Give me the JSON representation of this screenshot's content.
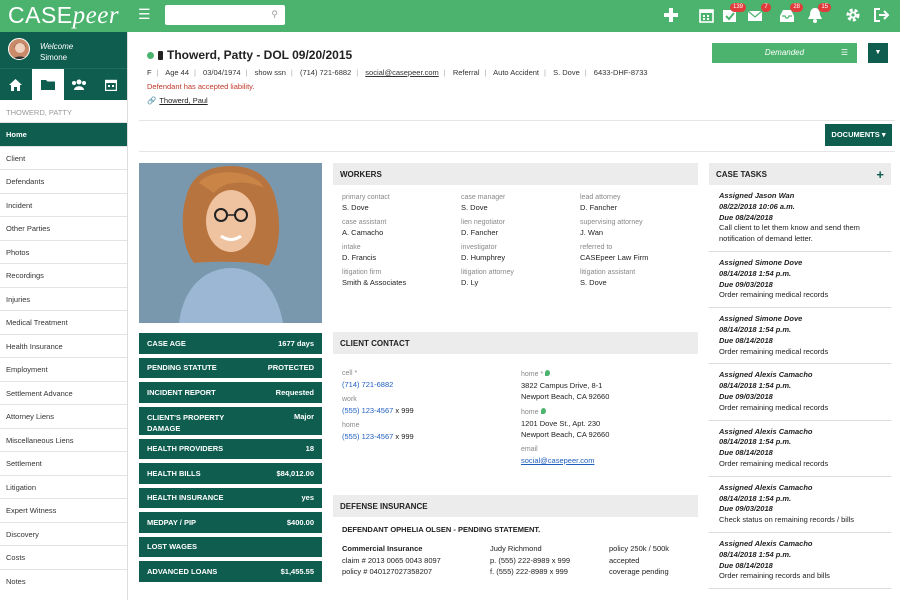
{
  "topbar": {
    "logo_case": "CASE",
    "logo_peer": "peer",
    "badges": [
      "139",
      "7",
      "28",
      "15"
    ]
  },
  "sidebar": {
    "welcome_label": "Welcome",
    "user_name": "Simone",
    "case_name": "THOWERD, PATTY",
    "items": [
      "Home",
      "Client",
      "Defendants",
      "Incident",
      "Other Parties",
      "Photos",
      "Recordings",
      "Injuries",
      "Medical Treatment",
      "Health Insurance",
      "Employment",
      "Settlement Advance",
      "Attorney Liens",
      "Miscellaneous Liens",
      "Settlement",
      "Litigation",
      "Expert Witness",
      "Discovery",
      "Costs",
      "Notes"
    ]
  },
  "header": {
    "title": "Thowerd, Patty - DOL 09/20/2015",
    "info": [
      "F",
      "Age 44",
      "03/04/1974",
      "show ssn",
      "(714) 721-6882",
      "social@casepeer.com",
      "Referral",
      "Auto Accident",
      "S. Dove",
      "6433-DHF-8733"
    ],
    "liability": "Defendant has accepted liability.",
    "linked": "Thowerd, Paul",
    "status": "Demanded",
    "documents": "DOCUMENTS ▾"
  },
  "stats": [
    {
      "label": "CASE AGE",
      "value": "1677 days"
    },
    {
      "label": "PENDING STATUTE",
      "value": "PROTECTED"
    },
    {
      "label": "INCIDENT REPORT",
      "value": "Requested"
    },
    {
      "label": "CLIENT'S PROPERTY DAMAGE",
      "value": "Major"
    },
    {
      "label": "HEALTH PROVIDERS",
      "value": "18"
    },
    {
      "label": "HEALTH BILLS",
      "value": "$84,012.00"
    },
    {
      "label": "HEALTH INSURANCE",
      "value": "yes"
    },
    {
      "label": "MEDPAY / PIP",
      "value": "$400.00"
    },
    {
      "label": "LOST WAGES",
      "value": ""
    },
    {
      "label": "ADVANCED LOANS",
      "value": "$1,455.55"
    }
  ],
  "workers": {
    "title": "WORKERS",
    "items": [
      {
        "k": "primary contact",
        "v": "S. Dove"
      },
      {
        "k": "case manager",
        "v": "S. Dove"
      },
      {
        "k": "lead attorney",
        "v": "D. Fancher"
      },
      {
        "k": "case assistant",
        "v": "A. Camacho"
      },
      {
        "k": "lien negotiator",
        "v": "D. Fancher"
      },
      {
        "k": "supervising attorney",
        "v": "J. Wan"
      },
      {
        "k": "intake",
        "v": "D. Francis"
      },
      {
        "k": "investigator",
        "v": "D. Humphrey"
      },
      {
        "k": "referred to",
        "v": "CASEpeer Law Firm"
      },
      {
        "k": "litigation firm",
        "v": "Smith & Associates"
      },
      {
        "k": "litigation attorney",
        "v": "D. Ly"
      },
      {
        "k": "litigation assistant",
        "v": "S. Dove"
      }
    ]
  },
  "contact": {
    "title": "CLIENT CONTACT",
    "cell_label": "cell *",
    "cell": "(714) 721-6882",
    "work_label": "work",
    "work": "(555) 123-4567",
    "work_ext": " x 999",
    "home_label": "home",
    "home": "(555) 123-4567",
    "home_ext": " x 999",
    "addr1_label": "home *",
    "addr1_line1": "3822 Campus Drive, 8-1",
    "addr1_line2": "Newport Beach, CA 92660",
    "addr2_label": "home",
    "addr2_line1": "1201 Dove St., Apt. 230",
    "addr2_line2": "Newport Beach, CA 92660",
    "email_label": "email",
    "email": "social@casepeer.com"
  },
  "defense": {
    "title": "DEFENSE INSURANCE",
    "subtitle": "DEFENDANT OPHELIA OLSEN - PENDING STATEMENT.",
    "company": "Commercial Insurance",
    "claim": "claim # 2013 0065 0043 8097",
    "policy": "policy # 040127027358207",
    "adjuster": "Judy Richmond",
    "phone": "p. (555) 222-8989 x 999",
    "fax": "f. (555) 222-8989 x 999",
    "limits": "policy 250k / 500k",
    "accepted": "accepted",
    "coverage": "coverage pending"
  },
  "tasks": {
    "title": "CASE TASKS",
    "items": [
      {
        "assigned": "Assigned Jason Wan",
        "created": "08/22/2018 10:06 a.m.",
        "due": "Due 08/24/2018",
        "text": "Call client to let them know and send them notification of demand letter."
      },
      {
        "assigned": "Assigned Simone Dove",
        "created": "08/14/2018 1:54 p.m.",
        "due": "Due 09/03/2018",
        "text": "Order remaining medical records"
      },
      {
        "assigned": "Assigned Simone Dove",
        "created": "08/14/2018 1:54 p.m.",
        "due": "Due 08/14/2018",
        "text": "Order remaining medical records"
      },
      {
        "assigned": "Assigned Alexis Camacho",
        "created": "08/14/2018 1:54 p.m.",
        "due": "Due 09/03/2018",
        "text": "Order remaining medical records"
      },
      {
        "assigned": "Assigned Alexis Camacho",
        "created": "08/14/2018 1:54 p.m.",
        "due": "Due 08/14/2018",
        "text": "Order remaining medical records"
      },
      {
        "assigned": "Assigned Alexis Camacho",
        "created": "08/14/2018 1:54 p.m.",
        "due": "Due 09/03/2018",
        "text": "Check status on remaining records / bills"
      },
      {
        "assigned": "Assigned Alexis Camacho",
        "created": "08/14/2018 1:54 p.m.",
        "due": "Due 08/14/2018",
        "text": "Order remaining records and bills"
      }
    ]
  }
}
